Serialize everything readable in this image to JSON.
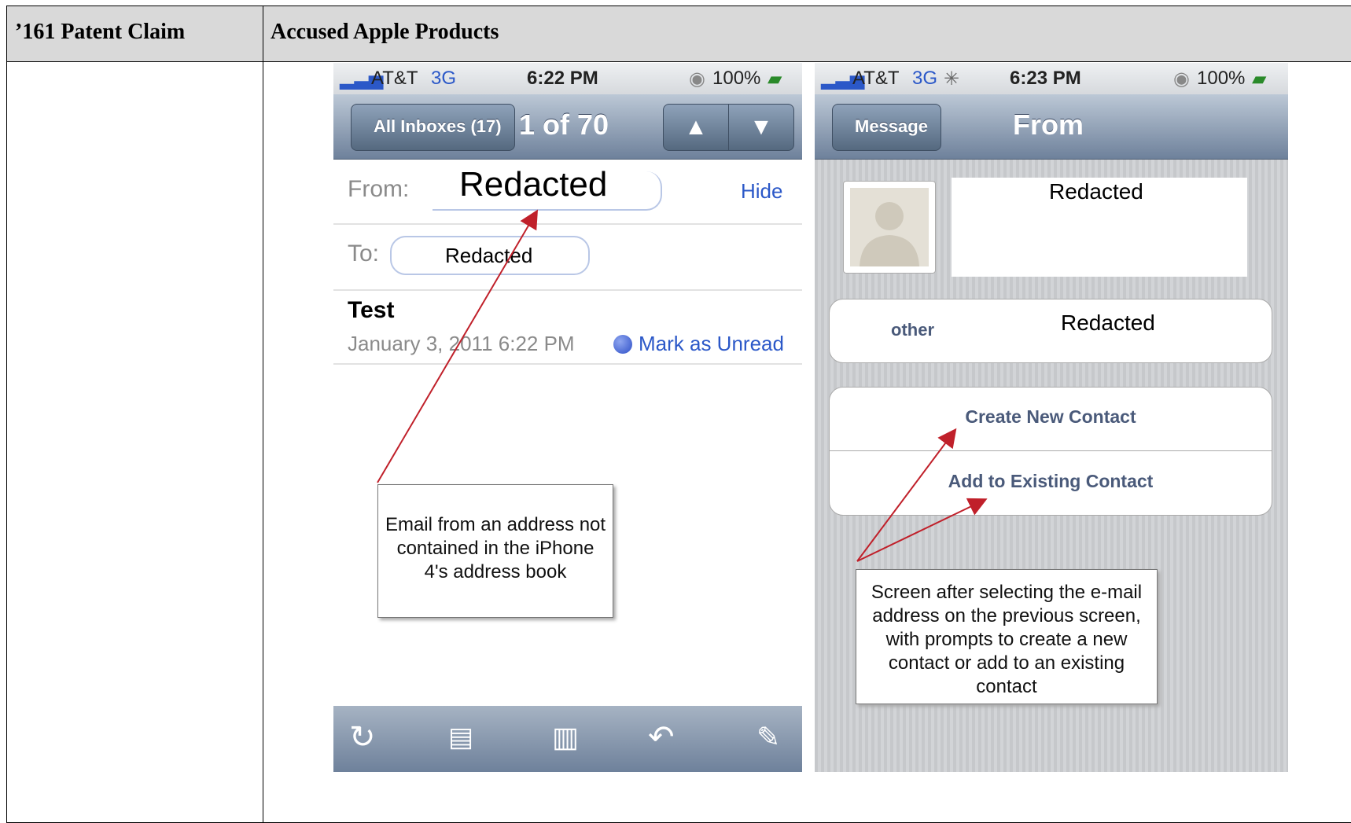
{
  "header": {
    "col1": "’161 Patent Claim",
    "col2": "Accused Apple Products"
  },
  "phone1": {
    "carrier": "AT&T",
    "network": "3G",
    "time": "6:22 PM",
    "battery": "100%",
    "back_label": "All Inboxes (17)",
    "title": "1 of 70",
    "from_label": "From:",
    "from_value": "Redacted",
    "hide_label": "Hide",
    "to_label": "To:",
    "to_value": "Redacted",
    "subject": "Test",
    "date": "January 3, 2011 6:22 PM",
    "mark_unread": "Mark as Unread",
    "callout": "Email from an address not contained in the iPhone 4's address book"
  },
  "phone2": {
    "carrier": "AT&T",
    "network": "3G",
    "time": "6:23 PM",
    "battery": "100%",
    "back_label": "Message",
    "title": "From",
    "name_value": "Redacted",
    "field_label": "other",
    "field_value": "Redacted",
    "create_contact": "Create New Contact",
    "add_existing": "Add to Existing Contact",
    "callout": "Screen after selecting the e-mail address on the previous screen, with prompts to create a new contact or add to an existing contact"
  },
  "colors": {
    "link_blue": "#2b58c8",
    "arrow_red": "#c0202a",
    "header_gray": "#d9d9d9"
  }
}
